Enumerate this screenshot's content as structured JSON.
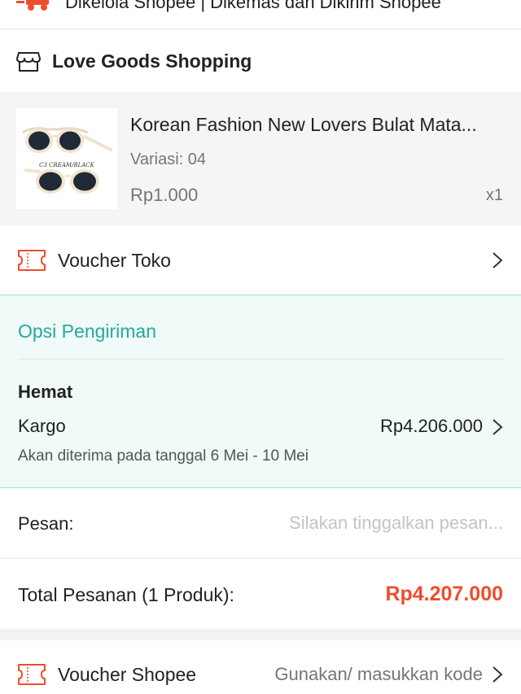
{
  "managed": {
    "text": "Dikelola Shopee | Dikemas dan Dikirim Shopee",
    "icon": "truck-icon"
  },
  "shop": {
    "name": "Love Goods Shopping",
    "icon": "store-icon"
  },
  "product": {
    "name": "Korean Fashion New Lovers Bulat Mata...",
    "variant": "Variasi: 04",
    "price": "Rp1.000",
    "quantity": "x1",
    "image_caption": "C3 CREAM/BLACK"
  },
  "voucher_toko": {
    "label": "Voucher Toko",
    "icon": "ticket-icon"
  },
  "shipping": {
    "title": "Opsi Pengiriman",
    "type": "Hemat",
    "courier": "Kargo",
    "price": "Rp4.206.000",
    "eta": "Akan diterima pada tanggal 6 Mei - 10 Mei"
  },
  "message": {
    "label": "Pesan:",
    "placeholder": "Silakan tinggalkan pesan..."
  },
  "total": {
    "label": "Total Pesanan (1 Produk):",
    "value": "Rp4.207.000"
  },
  "voucher_shopee": {
    "label": "Voucher Shopee",
    "hint": "Gunakan/ masukkan kode",
    "icon": "ticket-icon"
  },
  "colors": {
    "accent": "#ee4d2d",
    "teal": "#26aa99",
    "shipping_bg": "#effaf9"
  }
}
